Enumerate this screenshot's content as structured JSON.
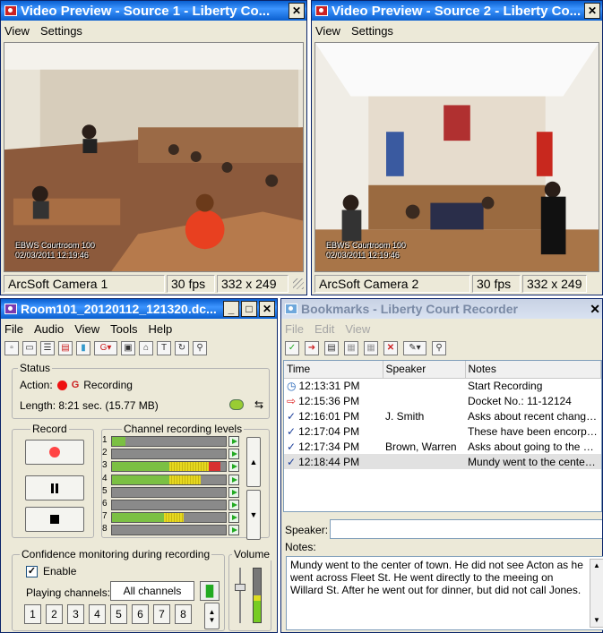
{
  "source1": {
    "title": "Video Preview - Source 1 - Liberty Co...",
    "close_label": "✕",
    "menu": [
      "View",
      "Settings"
    ],
    "overlay_line1": "EBWS Courtroom 100",
    "overlay_line2": "02/03/2011 12:19:46",
    "status": {
      "camera": "ArcSoft Camera 1",
      "fps": "30 fps",
      "resolution": "332 x 249"
    }
  },
  "source2": {
    "title": "Video Preview - Source 2 - Liberty Co...",
    "close_label": "✕",
    "menu": [
      "View",
      "Settings"
    ],
    "overlay_line1": "EBWS Courtroom 100",
    "overlay_line2": "02/03/2011 12:19:46",
    "status": {
      "camera": "ArcSoft Camera 2",
      "fps": "30 fps",
      "resolution": "332 x 249"
    }
  },
  "recorder": {
    "title": "Room101_20120112_121320.dc...",
    "min_label": "_",
    "max_label": "□",
    "close_label": "✕",
    "menu": [
      "File",
      "Audio",
      "View",
      "Tools",
      "Help"
    ],
    "status_legend": "Status",
    "action_label": "Action:",
    "action_value": "Recording",
    "length_text": "Length: 8:21 sec. (15.77 MB)",
    "record_legend": "Record",
    "levels_legend": "Channel recording levels",
    "channels": [
      {
        "num": "1",
        "level": 0.12,
        "peak": 0
      },
      {
        "num": "2",
        "level": 0,
        "peak": 0
      },
      {
        "num": "3",
        "level": 0.5,
        "yellow": 0.35,
        "red": 0.1
      },
      {
        "num": "4",
        "level": 0.5,
        "yellow": 0.28,
        "red": 0
      },
      {
        "num": "5",
        "level": 0,
        "peak": 0
      },
      {
        "num": "6",
        "level": 0,
        "peak": 0
      },
      {
        "num": "7",
        "level": 0.46,
        "yellow": 0.17,
        "red": 0
      },
      {
        "num": "8",
        "level": 0,
        "peak": 0
      }
    ],
    "confidence_legend": "Confidence monitoring during recording",
    "volume_legend": "Volume",
    "enable_label": "Enable",
    "enable_checked": true,
    "playing_label": "Playing channels:",
    "playing_value": "All channels",
    "channel_buttons": [
      "1",
      "2",
      "3",
      "4",
      "5",
      "6",
      "7",
      "8"
    ]
  },
  "bookmarks": {
    "title": "Bookmarks - Liberty Court Recorder",
    "close_label": "✕",
    "menu": [
      "File",
      "Edit",
      "View"
    ],
    "columns": [
      "Time",
      "Speaker",
      "Notes"
    ],
    "rows": [
      {
        "icon": "clock",
        "time": "12:13:31 PM",
        "speaker": "",
        "notes": "Start Recording"
      },
      {
        "icon": "arrow",
        "time": "12:15:36 PM",
        "speaker": "",
        "notes": "Docket No.: 11-12124"
      },
      {
        "icon": "check",
        "time": "12:16:01 PM",
        "speaker": "J. Smith",
        "notes": "Asks about recent change..."
      },
      {
        "icon": "check",
        "time": "12:17:04 PM",
        "speaker": "",
        "notes": "These have been encorpo..."
      },
      {
        "icon": "check",
        "time": "12:17:34 PM",
        "speaker": "Brown, Warren",
        "notes": "Asks about going to the ce..."
      },
      {
        "icon": "check",
        "time": "12:18:44 PM",
        "speaker": "",
        "notes": "Mundy went to the center of..."
      }
    ],
    "speaker_label": "Speaker:",
    "speaker_value": "",
    "notes_label": "Notes:",
    "notes_text": "Mundy went to the center of town. He did not see Acton as he went across Fleet St. He went directly to the meeing on Willard St. After he went out for dinner, but did not call Jones."
  }
}
